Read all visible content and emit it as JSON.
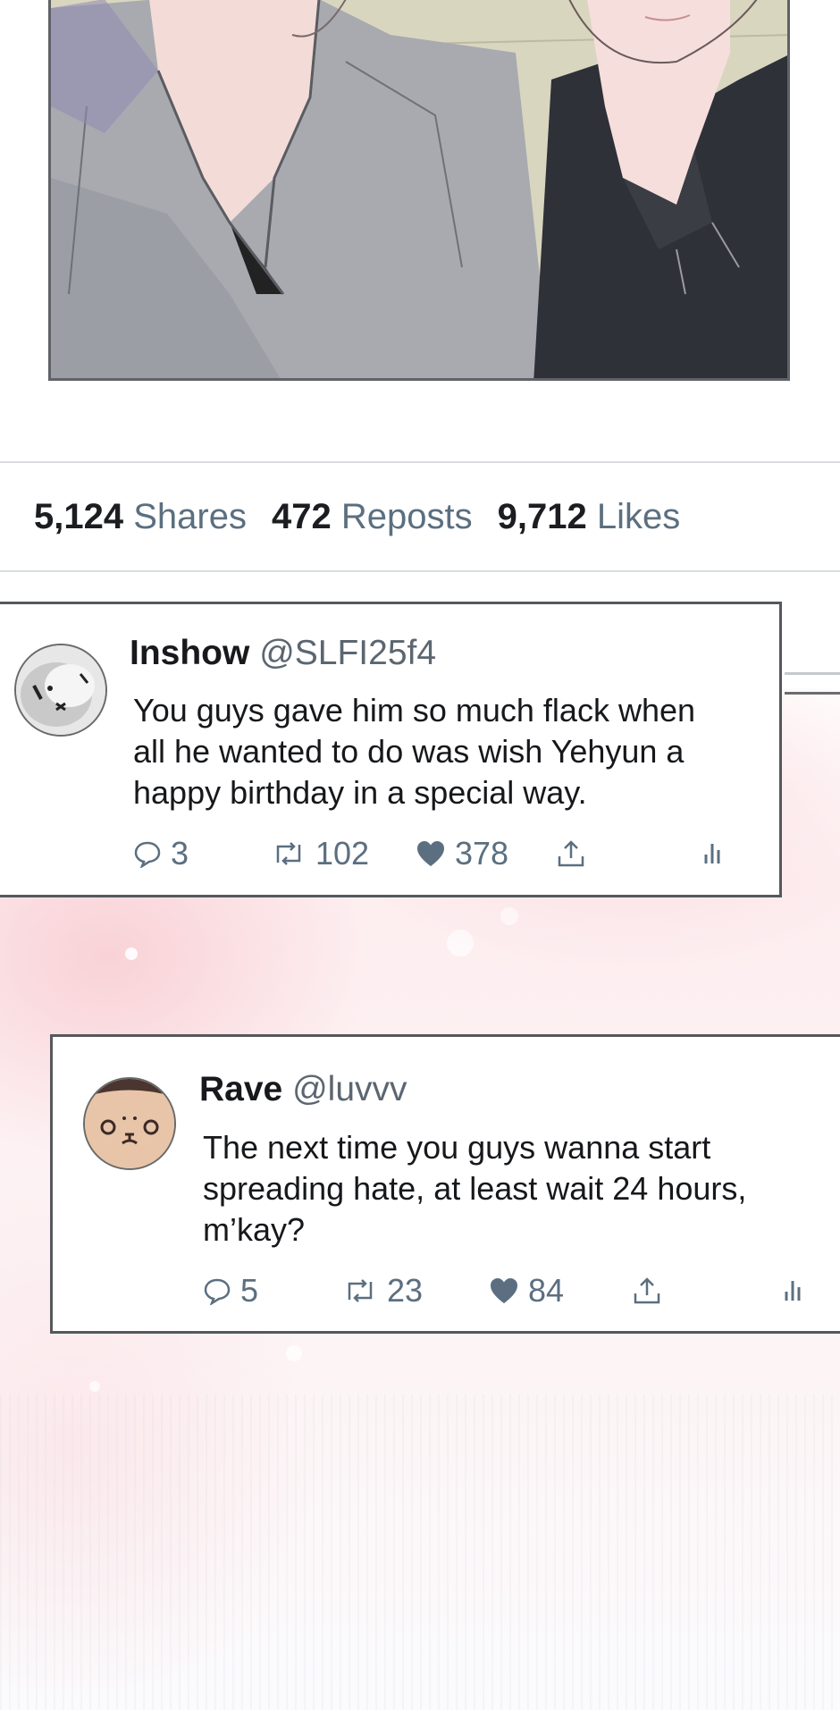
{
  "stats": {
    "shares": {
      "count": "5,124",
      "label": "Shares"
    },
    "reposts": {
      "count": "472",
      "label": "Reposts"
    },
    "likes": {
      "count": "9,712",
      "label": "Likes"
    }
  },
  "comments": [
    {
      "name": "Inshow",
      "handle": "@SLFI25f4",
      "text": "You guys gave him so much flack when\nall he wanted to do was wish Yehyun a\nhappy birthday in a special way.",
      "replies": "3",
      "reposts": "102",
      "likes": "378",
      "icons": [
        "reply-icon",
        "repost-icon",
        "heart-icon",
        "share-icon",
        "analytics-icon"
      ]
    },
    {
      "name": "Rave",
      "handle": "@luvvv",
      "text": "The next time you guys wanna start\nspreading hate, at least wait 24 hours,\nm’kay?",
      "replies": "5",
      "reposts": "23",
      "likes": "84",
      "icons": [
        "reply-icon",
        "repost-icon",
        "heart-icon",
        "share-icon",
        "analytics-icon"
      ]
    }
  ],
  "colors": {
    "accent_gray": "#5b6f80",
    "border": "#55585c",
    "pink_bg": "#fdeef0"
  }
}
